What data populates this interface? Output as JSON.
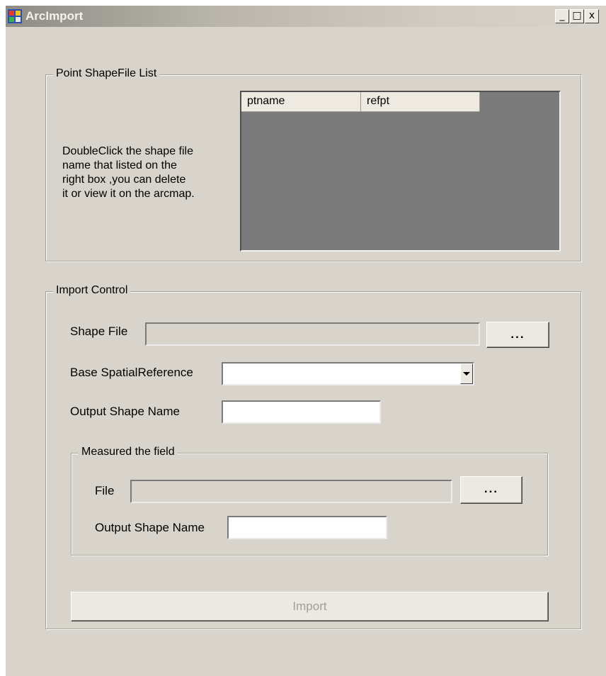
{
  "window": {
    "title": "ArcImport",
    "controls": {
      "minimize": "_",
      "maximize": "□",
      "close": "x"
    }
  },
  "point_list_group": {
    "legend": "Point ShapeFile List",
    "description": "DoubleClick the shape file\nname that listed on the\nright box ,you can delete\nit or view it on the arcmap.",
    "columns": [
      "ptname",
      "refpt"
    ]
  },
  "import_control": {
    "legend": "Import Control",
    "shape_file_label": "Shape File",
    "shape_file_value": "",
    "browse_label": "...",
    "base_ref_label": "Base SpatialReference",
    "base_ref_value": "",
    "output_name_label": "Output Shape Name",
    "output_name_value": "",
    "measured": {
      "legend": "Measured the field",
      "file_label": "File",
      "file_value": "",
      "browse_label": "...",
      "output_name_label": "Output Shape Name",
      "output_name_value": ""
    },
    "import_button": "Import"
  }
}
